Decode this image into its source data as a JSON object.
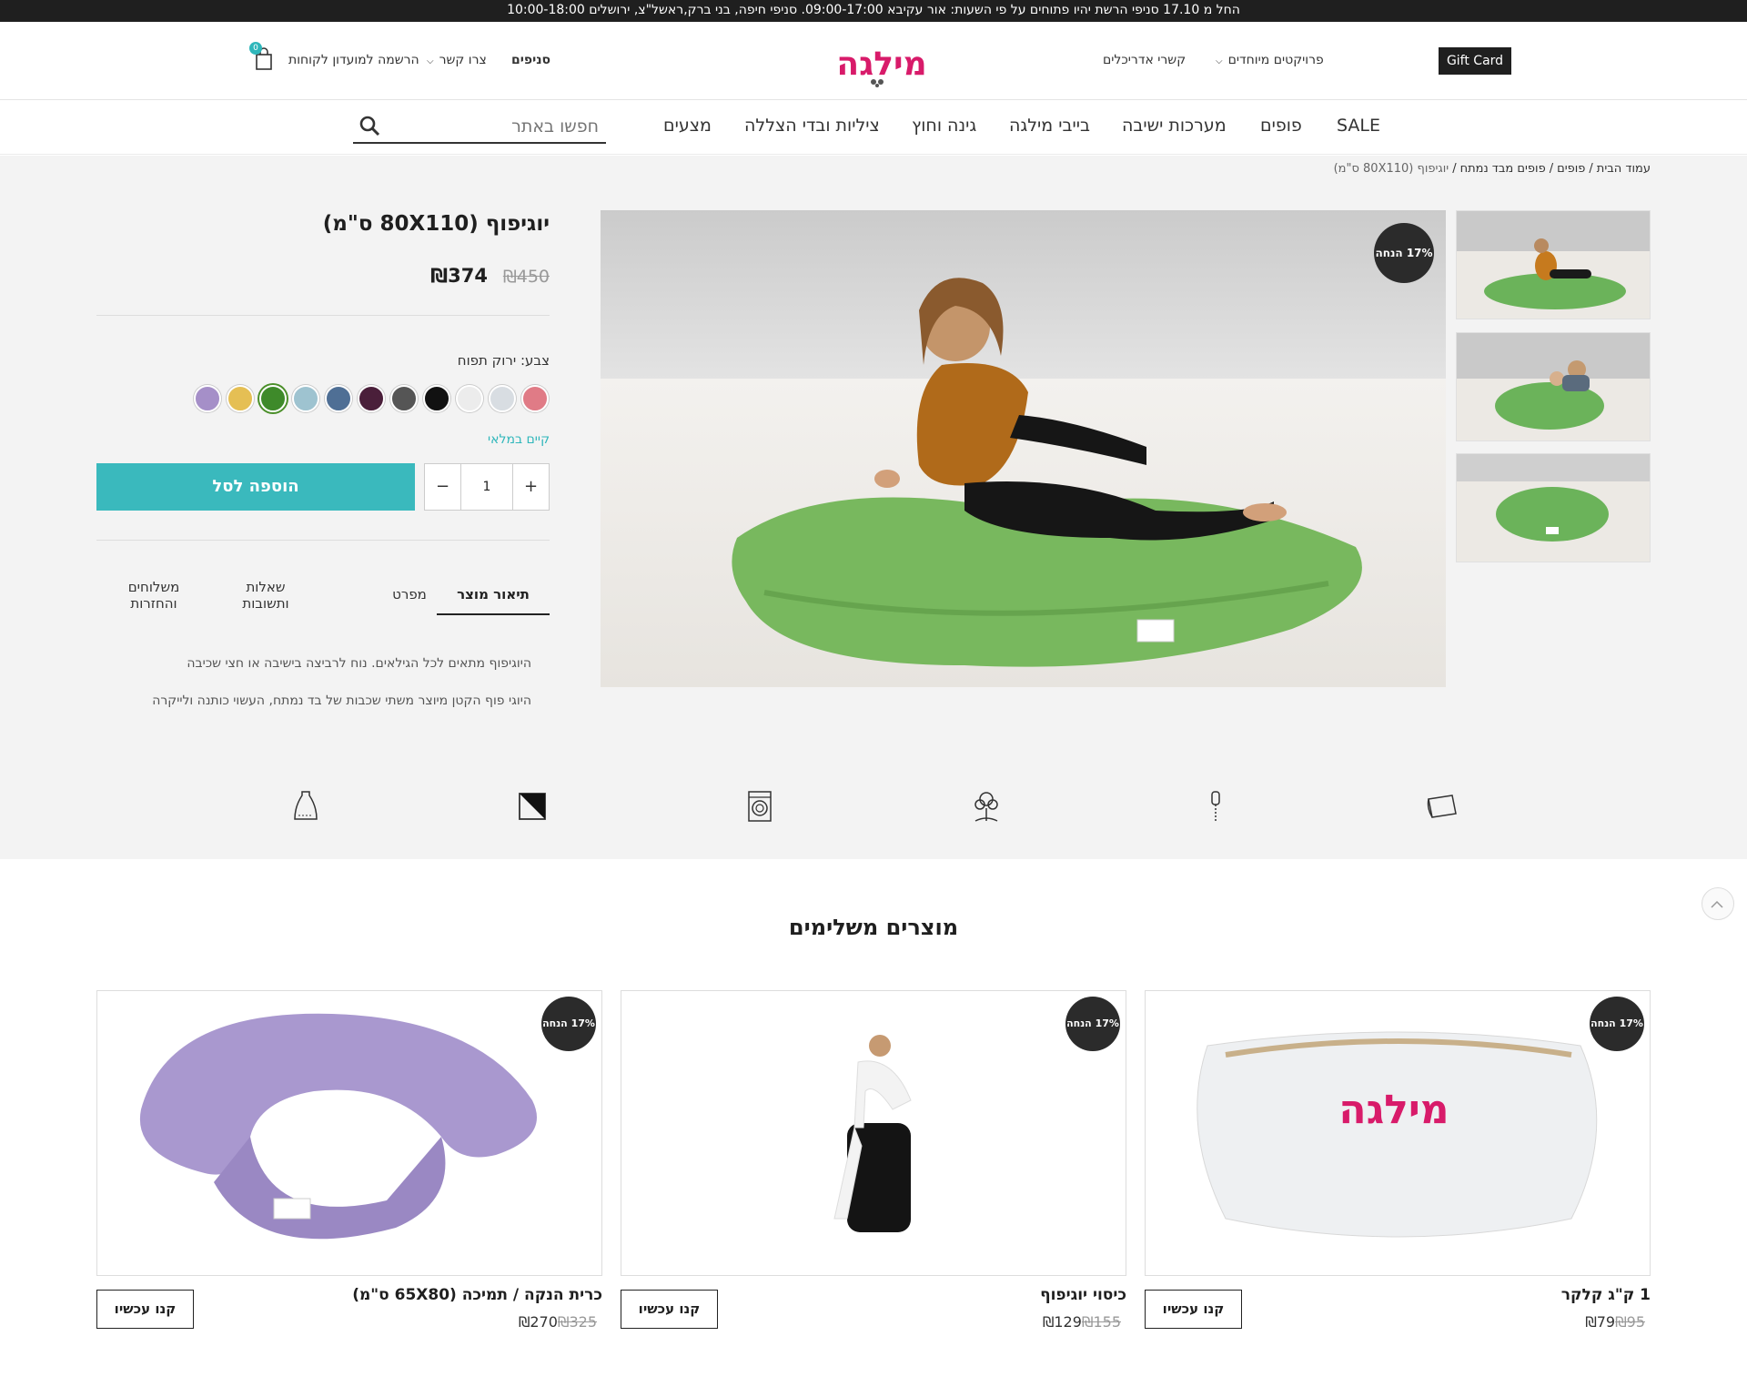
{
  "announcement": "החל מ 17.10 סניפי הרשת יהיו פתוחים על פי השעות: אור עקיבא 09:00-17:00. סניפי חיפה, בני ברק,ראשל\"צ, ירושלים 10:00-18:00",
  "header": {
    "gift_card": "Gift Card",
    "special_projects": "פרויקטים מיוחדים",
    "designers": "קשרי אדריכלים",
    "branches": "סניפים",
    "contact": "צרו קשר",
    "club": "הרשמה למועדון לקוחות",
    "cart_count": "0",
    "logo_text": "מילגה"
  },
  "nav": {
    "items": [
      "SALE",
      "פופים",
      "מערכות ישיבה",
      "בייבי מילגה",
      "גינה וחוץ",
      "ציליות ובדי הצללה",
      "מצעים"
    ],
    "search_placeholder": "חפשו באתר"
  },
  "breadcrumb": {
    "home": "עמוד הבית",
    "cat1": "פופים",
    "cat2": "פופים מבד נמתח",
    "current": "יוגיפוף (80X110 ס\"מ)"
  },
  "product": {
    "title": "יוגיפוף (80X110 ס\"מ)",
    "price_now": "₪374",
    "price_old": "₪450",
    "discount_badge": "17% הנחה",
    "color_label": "צבע: ירוק תפוח",
    "swatches": [
      "#e07b86",
      "#d8dde2",
      "#ececec",
      "#111111",
      "#555555",
      "#4a1f3a",
      "#4f6f95",
      "#9ec3d0",
      "#3e8a2a",
      "#e5bf54",
      "#a58fc8"
    ],
    "stock": "קיים במלאי",
    "qty": "1",
    "add_to_cart": "הוספה לסל",
    "tabs": [
      "תיאור מוצר",
      "מפרט",
      "שאלות ותשובות",
      "משלוחים והחזרות"
    ],
    "desc1": "היוגיפוף מתאים לכל הגילאים. נוח לרביצה בישיבה או חצי שכיבה",
    "desc2": "היוגי פוף הקטן מיוצר משתי שכבות של בד נמתח, העשוי כותנה ולייקרה"
  },
  "features_icons": [
    "fabric-icon",
    "zipper-icon",
    "cotton-icon",
    "washing-machine-icon",
    "color-icon",
    "filling-bag-icon"
  ],
  "related": {
    "title": "מוצרים משלימים",
    "items": [
      {
        "name": "1 ק\"ג קלקר",
        "price": "₪79",
        "old": "₪95",
        "badge": "17% הנחה",
        "btn": "קנו עכשיו"
      },
      {
        "name": "כיסוי יוגיפוף",
        "price": "₪129",
        "old": "₪155",
        "badge": "17% הנחה",
        "btn": "קנו עכשיו"
      },
      {
        "name": "כרית הנקה / תמיכה (65X80 ס\"מ)",
        "price": "₪270",
        "old": "₪325",
        "badge": "17% הנחה",
        "btn": "קנו עכשיו"
      }
    ]
  }
}
